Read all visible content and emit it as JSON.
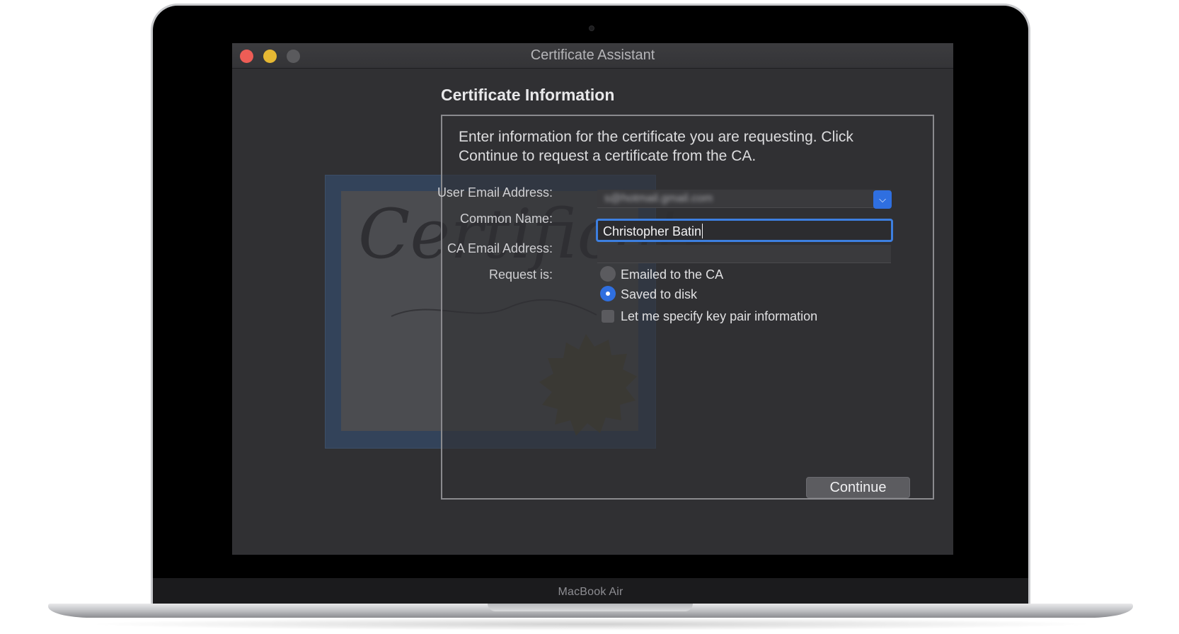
{
  "device": {
    "brand": "MacBook Air"
  },
  "window": {
    "title": "Certificate Assistant",
    "traffic_lights": [
      "close",
      "minimize",
      "zoom"
    ]
  },
  "main": {
    "heading": "Certificate Information",
    "intro": "Enter information for the certificate you are requesting. Click Continue to request a certificate from the CA.",
    "form": {
      "user_email_label": "User Email Address:",
      "user_email_value": "s@hotmail.gmail.com",
      "common_name_label": "Common Name:",
      "common_name_value": "Christopher Batin",
      "ca_email_label": "CA Email Address:",
      "ca_email_value": "",
      "request_label": "Request is:",
      "options": [
        {
          "label": "Emailed to the CA",
          "selected": false
        },
        {
          "label": "Saved to disk",
          "selected": true
        }
      ],
      "key_pair_label": "Let me specify key pair information",
      "key_pair_checked": false
    },
    "continue_label": "Continue"
  },
  "decoration": {
    "certificate_script": "Certificate"
  },
  "colors": {
    "accent": "#2f6fe0",
    "window_bg": "#303033",
    "close": "#ee5d56",
    "minimize": "#e6b833",
    "zoom_disabled": "#5a5a5d"
  }
}
